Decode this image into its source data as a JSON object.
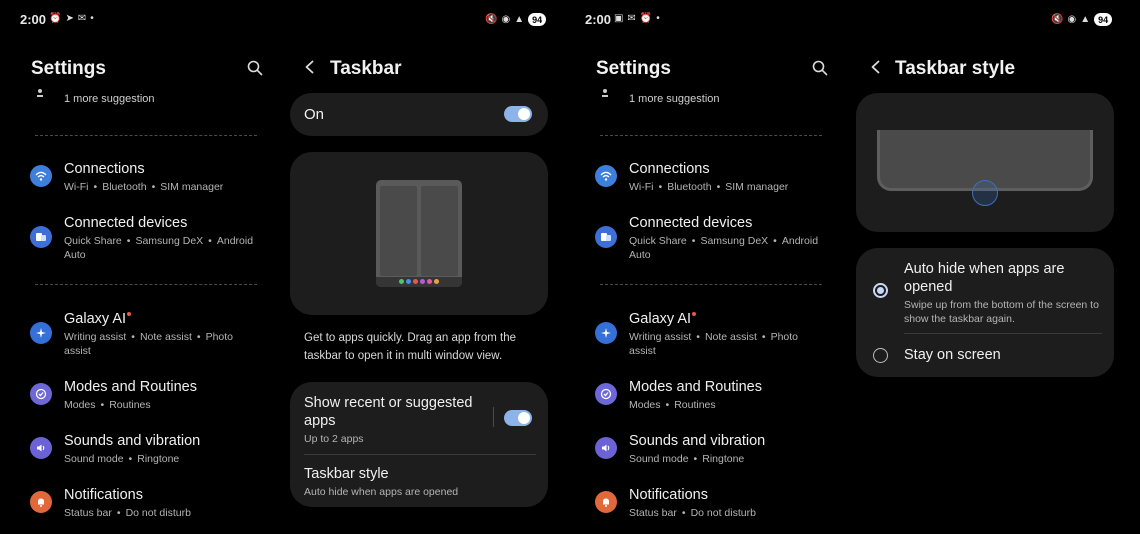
{
  "status": {
    "time": "2:00",
    "battery": "94"
  },
  "settings": {
    "title": "Settings",
    "suggestion": "1 more suggestion",
    "items": [
      {
        "title": "Connections",
        "subs": [
          "Wi-Fi",
          "Bluetooth",
          "SIM manager"
        ]
      },
      {
        "title": "Connected devices",
        "line1": [
          "Quick Share",
          "Samsung DeX",
          "Android"
        ],
        "line2": "Auto"
      },
      {
        "title": "Galaxy AI",
        "line1": [
          "Writing assist",
          "Note assist",
          "Photo"
        ],
        "line2": "assist"
      },
      {
        "title": "Modes and Routines",
        "subs": [
          "Modes",
          "Routines"
        ]
      },
      {
        "title": "Sounds and vibration",
        "subs": [
          "Sound mode",
          "Ringtone"
        ]
      },
      {
        "title": "Notifications",
        "subs": [
          "Status bar",
          "Do not disturb"
        ]
      }
    ]
  },
  "taskbar": {
    "title": "Taskbar",
    "on_label": "On",
    "description_line1": "Get to apps quickly. Drag an app from the",
    "description_line2": "taskbar to open it in multi window view.",
    "recent_title_line1": "Show recent or suggested",
    "recent_title_line2": "apps",
    "recent_sub": "Up to 2 apps",
    "style_title": "Taskbar style",
    "style_sub": "Auto hide when apps are opened"
  },
  "taskbar_style": {
    "title": "Taskbar style",
    "option1_title_line1": "Auto hide when apps are",
    "option1_title_line2": "opened",
    "option1_sub_line1": "Swipe up from the bottom of the screen to",
    "option1_sub_line2": "show the taskbar again.",
    "option2_title": "Stay on screen"
  },
  "colors": {
    "connections": "#3f7fdc",
    "connected_devices": "#3d6fd6",
    "galaxy_ai": "#3470d8",
    "modes": "#6d67d8",
    "sounds": "#6b62d6",
    "notifications": "#e0683a",
    "toggle": "#8cb3ea"
  }
}
